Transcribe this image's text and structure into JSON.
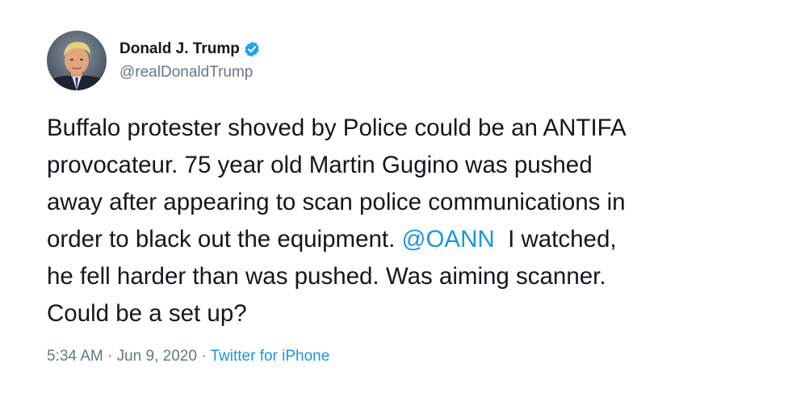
{
  "author": {
    "display_name": "Donald J. Trump",
    "handle": "@realDonaldTrump",
    "verified": true
  },
  "tweet": {
    "lines": [
      {
        "text": "Buffalo protester shoved by Police could be an ANTIFA"
      },
      {
        "text": "provocateur. 75 year old Martin Gugino was pushed"
      },
      {
        "text": "away after appearing to scan police communications in"
      },
      {
        "before": "order to black out the equipment. ",
        "mention": "@OANN",
        "after": "  I watched,"
      },
      {
        "text": "he fell harder than was pushed. Was aiming scanner."
      },
      {
        "text": "Could be a set up?"
      }
    ]
  },
  "meta": {
    "time": "5:34 AM",
    "separator1": " · ",
    "date": "Jun 9, 2020",
    "separator2": " · ",
    "source": "Twitter for iPhone"
  },
  "colors": {
    "text": "#14171a",
    "secondary": "#657786",
    "link": "#1b95e0",
    "verified_badge": "#1da1f2"
  },
  "icons": {
    "verified": "verified-badge-icon",
    "avatar": "profile-avatar"
  }
}
